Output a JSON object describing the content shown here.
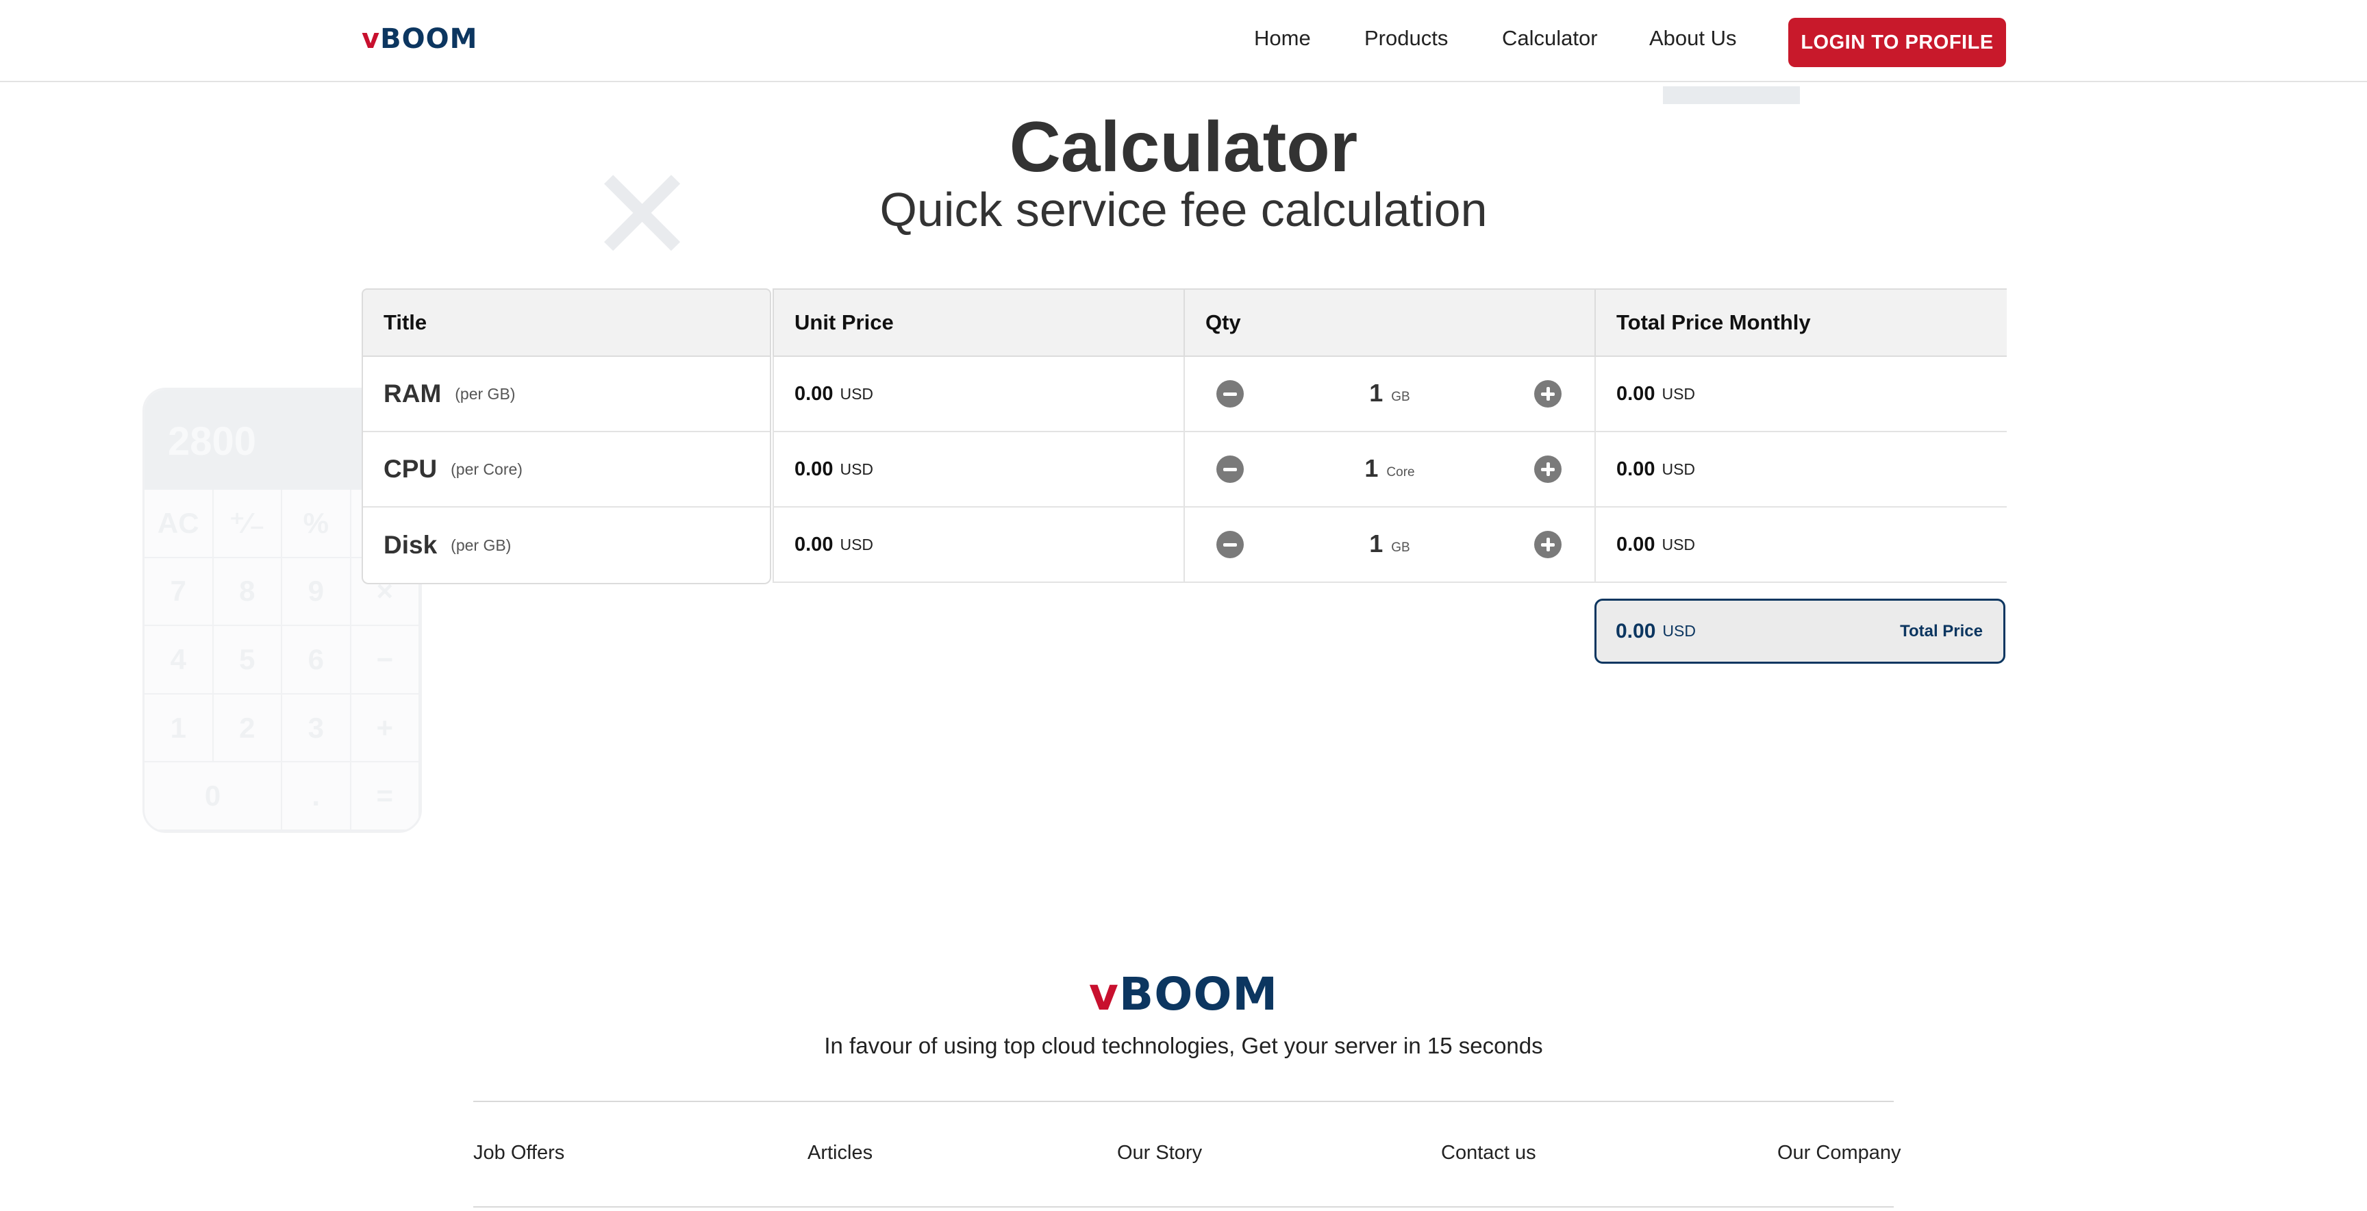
{
  "brand": {
    "logo_v": "v",
    "logo_rest": "BOOM"
  },
  "nav": {
    "items": [
      {
        "label": "Home"
      },
      {
        "label": "Products"
      },
      {
        "label": "Calculator"
      },
      {
        "label": "About Us"
      }
    ],
    "login_label": "LOGIN TO PROFILE"
  },
  "hero": {
    "title": "Calculator",
    "subtitle": "Quick service fee calculation"
  },
  "decorative_calculator": {
    "display": "2800",
    "keys": [
      "AC",
      "⁺∕₋",
      "%",
      "÷",
      "7",
      "8",
      "9",
      "×",
      "4",
      "5",
      "6",
      "−",
      "1",
      "2",
      "3",
      "+",
      "0",
      ".",
      "="
    ]
  },
  "table": {
    "headers": {
      "title": "Title",
      "unit_price": "Unit Price",
      "qty": "Qty",
      "total": "Total Price Monthly"
    },
    "rows": [
      {
        "name": "RAM",
        "unit": "(per GB)",
        "unit_price": "0.00",
        "currency": "USD",
        "qty": "1",
        "qty_unit": "GB",
        "total": "0.00"
      },
      {
        "name": "CPU",
        "unit": "(per Core)",
        "unit_price": "0.00",
        "currency": "USD",
        "qty": "1",
        "qty_unit": "Core",
        "total": "0.00"
      },
      {
        "name": "Disk",
        "unit": "(per GB)",
        "unit_price": "0.00",
        "currency": "USD",
        "qty": "1",
        "qty_unit": "GB",
        "total": "0.00"
      }
    ],
    "grand_total": {
      "value": "0.00",
      "currency": "USD",
      "label": "Total Price"
    }
  },
  "footer": {
    "logo_v": "v",
    "logo_rest": "BOOM",
    "tagline": "In favour of using top cloud technologies, Get your server in 15 seconds",
    "links": [
      {
        "label": "Job Offers"
      },
      {
        "label": "Articles"
      },
      {
        "label": "Our Story"
      },
      {
        "label": "Contact us"
      },
      {
        "label": "Our Company"
      }
    ]
  },
  "colors": {
    "brand_red": "#c8192b",
    "brand_navy": "#0c3660"
  }
}
